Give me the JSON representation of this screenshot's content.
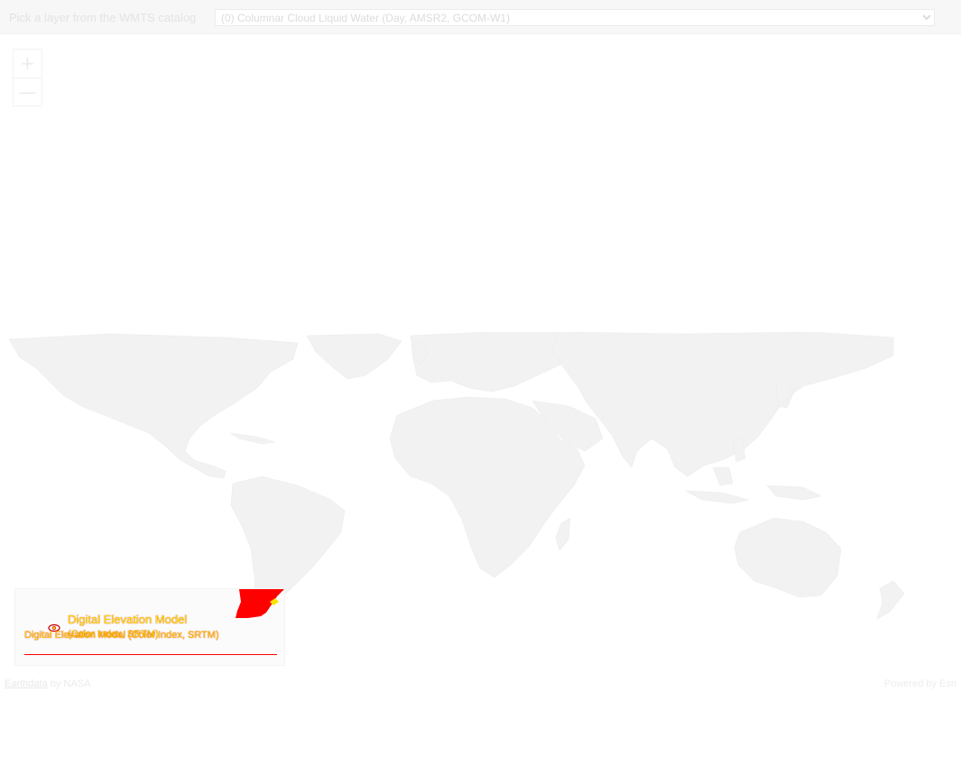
{
  "header": {
    "label": "Pick a layer from the WMTS catalog",
    "select_value": "(0) Columnar Cloud Liquid Water (Day, AMSR2, GCOM-W1)"
  },
  "zoom": {
    "in_icon": "plus-icon",
    "out_icon": "minus-icon",
    "in_symbol": "+",
    "out_symbol": "—"
  },
  "legend": {
    "title": "Digital Elevation Model",
    "subtitle": "(Color Index, SRTM)",
    "layer_name": "Digital Elevation Model (Color Index, SRTM)",
    "icon": "eye-icon",
    "colors": {
      "text": "#ffe100",
      "accent": "#ff0000"
    }
  },
  "footer": {
    "link": "Earthdata",
    "by": " by NASA",
    "powered": "Powered by Esri"
  }
}
